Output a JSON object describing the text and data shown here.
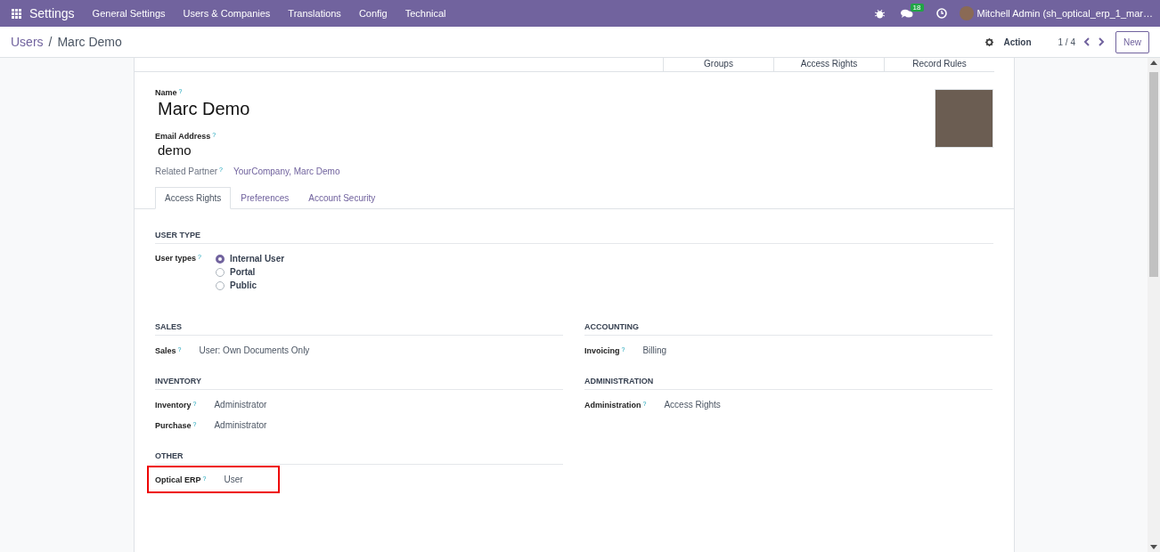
{
  "navbar": {
    "app_name": "Settings",
    "menu": [
      "General Settings",
      "Users & Companies",
      "Translations",
      "Config",
      "Technical"
    ],
    "messages_count": "18",
    "user": "Mitchell Admin (sh_optical_erp_1_mar…"
  },
  "control_panel": {
    "breadcrumb": [
      "Users",
      "Marc Demo"
    ],
    "separator": "/",
    "action": "Action",
    "pager": "1 / 4",
    "new_button": "New"
  },
  "stat_buttons": [
    "Groups",
    "Access Rights",
    "Record Rules"
  ],
  "form": {
    "name_label": "Name",
    "name_help": "?",
    "name": "Marc Demo",
    "email_label": "Email Address",
    "email_help": "?",
    "email": "demo",
    "partner_label": "Related Partner",
    "partner_help": "?",
    "partner": "YourCompany, Marc Demo"
  },
  "tabs": [
    {
      "label": "Access Rights",
      "selected": true
    },
    {
      "label": "Preferences",
      "selected": false
    },
    {
      "label": "Account Security",
      "selected": false
    }
  ],
  "user_type": {
    "title": "USER TYPE",
    "label": "User types",
    "help": "?",
    "options": [
      {
        "label": "Internal User",
        "selected": true
      },
      {
        "label": "Portal",
        "selected": false
      },
      {
        "label": "Public",
        "selected": false
      }
    ]
  },
  "sections": [
    {
      "title": "SALES",
      "fields": [
        {
          "label": "Sales",
          "help": "?",
          "value": "User: Own Documents Only",
          "highlighted": false
        }
      ]
    },
    {
      "title": "ACCOUNTING",
      "fields": [
        {
          "label": "Invoicing",
          "help": "?",
          "value": "Billing",
          "highlighted": false
        }
      ]
    },
    {
      "title": "INVENTORY",
      "fields": [
        {
          "label": "Inventory",
          "help": "?",
          "value": "Administrator",
          "highlighted": false
        },
        {
          "label": "Purchase",
          "help": "?",
          "value": "Administrator",
          "highlighted": false
        }
      ]
    },
    {
      "title": "ADMINISTRATION",
      "fields": [
        {
          "label": "Administration",
          "help": "?",
          "value": "Access Rights",
          "highlighted": false
        }
      ]
    },
    {
      "title": "OTHER",
      "fields": [
        {
          "label": "Optical ERP",
          "help": "?",
          "value": "User",
          "highlighted": true
        }
      ]
    }
  ]
}
